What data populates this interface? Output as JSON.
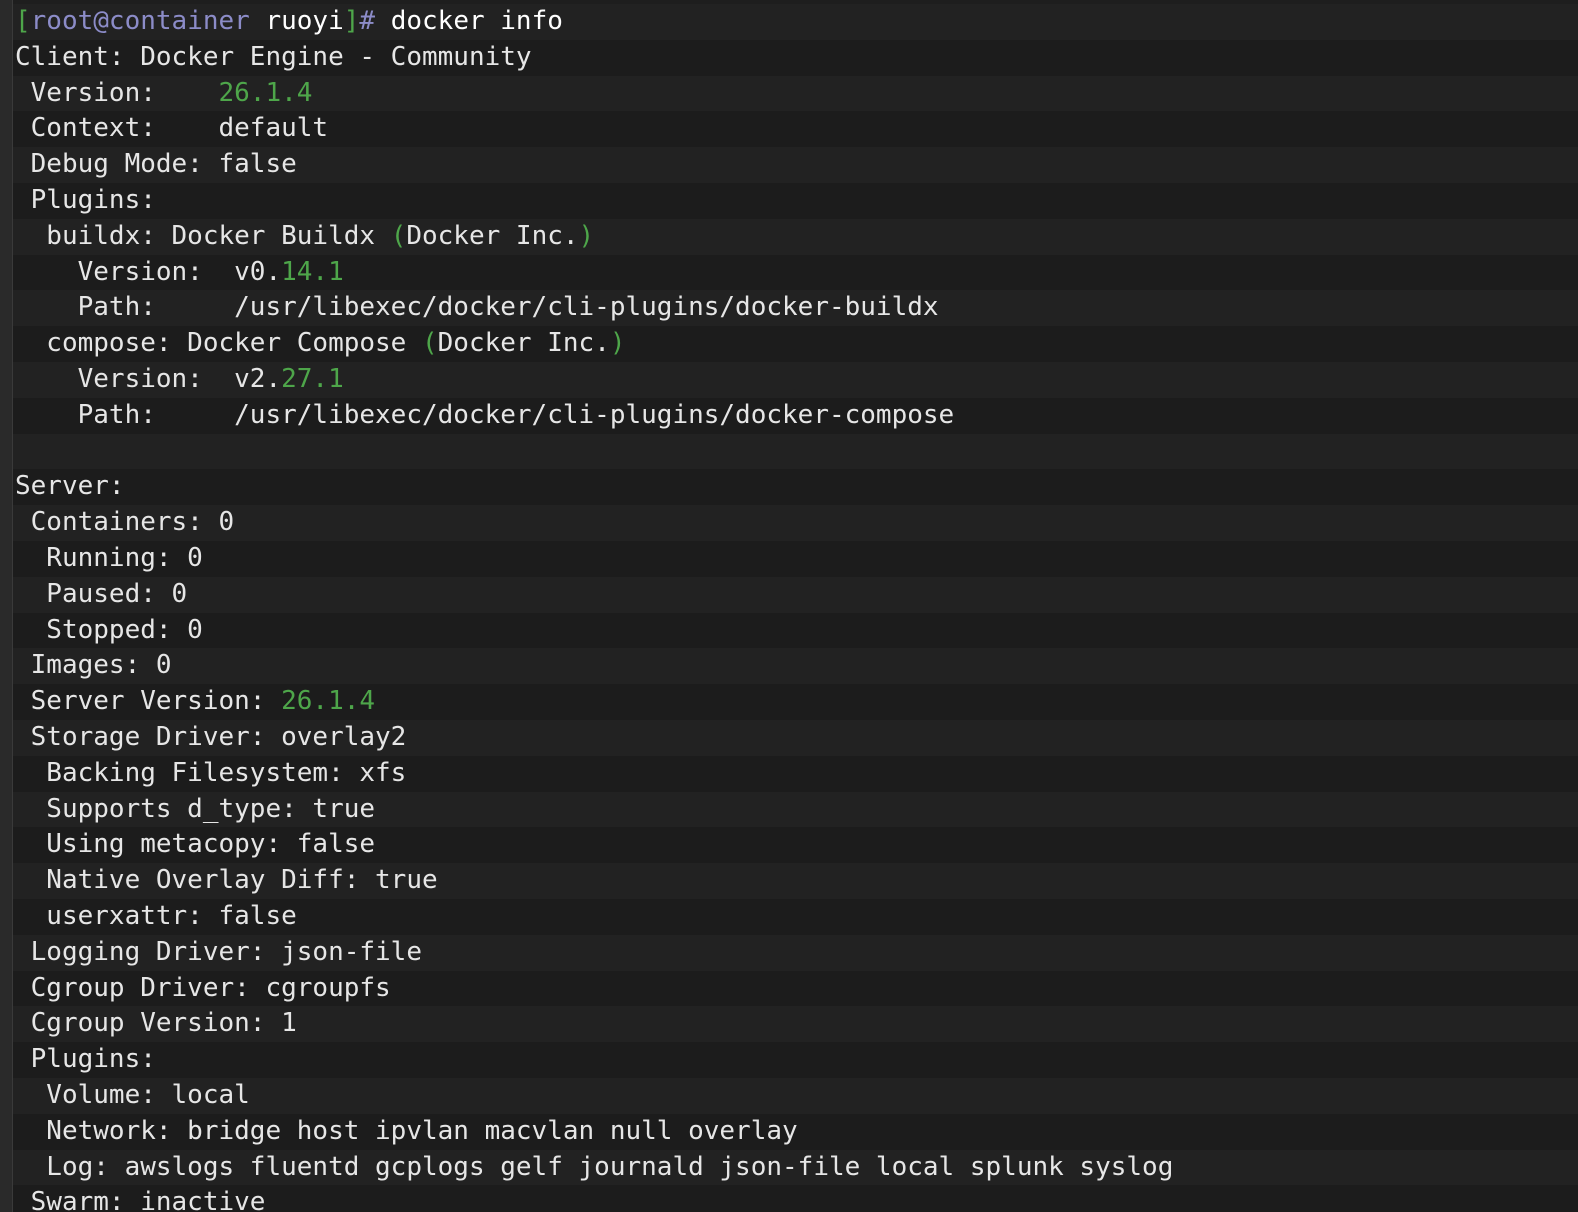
{
  "prompt": {
    "open_bracket": "[",
    "user_host": "root@container",
    "dir": " ruoyi",
    "close_bracket": "]",
    "symbol": "#",
    "command": " docker info"
  },
  "lines": [
    [
      {
        "t": "Client: Docker Engine - Community"
      }
    ],
    [
      {
        "t": " Version:    "
      },
      {
        "t": "26.1.4",
        "c": "green"
      }
    ],
    [
      {
        "t": " Context:    default"
      }
    ],
    [
      {
        "t": " Debug Mode: false"
      }
    ],
    [
      {
        "t": " Plugins:"
      }
    ],
    [
      {
        "t": "  buildx: Docker Buildx "
      },
      {
        "t": "(",
        "c": "green"
      },
      {
        "t": "Docker Inc."
      },
      {
        "t": ")",
        "c": "green"
      }
    ],
    [
      {
        "t": "    Version:  v0."
      },
      {
        "t": "14.1",
        "c": "green"
      }
    ],
    [
      {
        "t": "    Path:     /usr/libexec/docker/cli-plugins/docker-buildx"
      }
    ],
    [
      {
        "t": "  compose: Docker Compose "
      },
      {
        "t": "(",
        "c": "green"
      },
      {
        "t": "Docker Inc."
      },
      {
        "t": ")",
        "c": "green"
      }
    ],
    [
      {
        "t": "    Version:  v2."
      },
      {
        "t": "27.1",
        "c": "green"
      }
    ],
    [
      {
        "t": "    Path:     /usr/libexec/docker/cli-plugins/docker-compose"
      }
    ],
    [
      {
        "t": ""
      }
    ],
    [
      {
        "t": "Server:"
      }
    ],
    [
      {
        "t": " Containers: 0"
      }
    ],
    [
      {
        "t": "  Running: 0"
      }
    ],
    [
      {
        "t": "  Paused: 0"
      }
    ],
    [
      {
        "t": "  Stopped: 0"
      }
    ],
    [
      {
        "t": " Images: 0"
      }
    ],
    [
      {
        "t": " Server Version: "
      },
      {
        "t": "26.1.4",
        "c": "green"
      }
    ],
    [
      {
        "t": " Storage Driver: overlay2"
      }
    ],
    [
      {
        "t": "  Backing Filesystem: xfs"
      }
    ],
    [
      {
        "t": "  Supports d_type: true"
      }
    ],
    [
      {
        "t": "  Using metacopy: false"
      }
    ],
    [
      {
        "t": "  Native Overlay Diff: true"
      }
    ],
    [
      {
        "t": "  userxattr: false"
      }
    ],
    [
      {
        "t": " Logging Driver: json-file"
      }
    ],
    [
      {
        "t": " Cgroup Driver: cgroupfs"
      }
    ],
    [
      {
        "t": " Cgroup Version: 1"
      }
    ],
    [
      {
        "t": " Plugins:"
      }
    ],
    [
      {
        "t": "  Volume: local"
      }
    ],
    [
      {
        "t": "  Network: bridge host ipvlan macvlan null overlay"
      }
    ],
    [
      {
        "t": "  Log: awslogs fluentd gcplogs gelf journald json-file local splunk syslog"
      }
    ],
    [
      {
        "t": " Swarm: inactive"
      }
    ]
  ],
  "colors": {
    "background": "#1e1e1e",
    "text": "#e6e6e6",
    "green": "#4ea64a",
    "prompt_user": "#8c8cc8"
  }
}
